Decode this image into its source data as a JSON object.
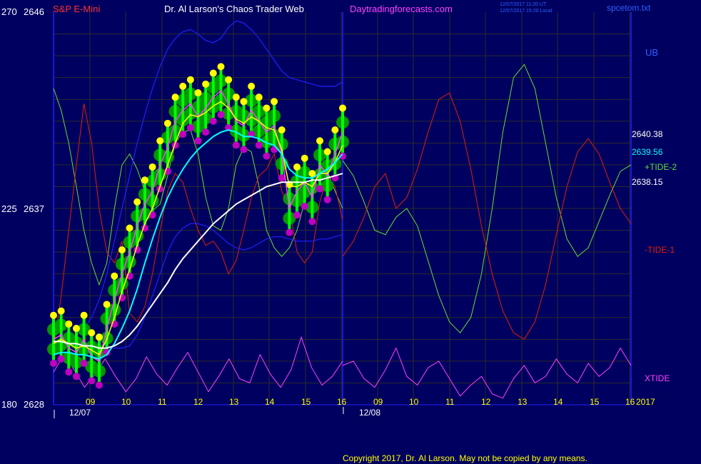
{
  "header": {
    "symbol": "S&P E-Mini",
    "title": "Dr. Al Larson's Chaos Trader Web",
    "site": "Daytradingforecasts.com",
    "timestamp_1": "12/07/2017 11:20 UT",
    "timestamp_2": "12/07/2017 15:20 Local",
    "file": "spcetom.txt"
  },
  "footer": {
    "copyright": "Copyright 2017, Dr. Al Larson. May not be copied by any means."
  },
  "colors": {
    "background": "#000060",
    "grid": "#2b2b2b",
    "cursor": "#2020ff",
    "band": "#2020ff",
    "price": "#00ff00",
    "price_halo": "#009900",
    "high_dot": "#ffff00",
    "low_dot": "#c000c0",
    "fast_avg": "#ffff00",
    "med_avg": "#ff40ff",
    "slow_avg": "#00ffff",
    "long_avg": "#ffffff",
    "tide_plus2": "#66dd33",
    "tide_minus1": "#e02000",
    "xtide": "#ff40ff",
    "text_white": "#ffffff",
    "text_yellow": "#ffff00",
    "text_red": "#ff3030",
    "text_magenta": "#ff40ff",
    "text_blue": "#3060ff"
  },
  "chart_data": {
    "type": "line",
    "title": "S&P E-Mini",
    "ylim": [
      2628,
      2646
    ],
    "left_axis": [
      {
        "left": "270",
        "right": "2646"
      },
      {
        "left": "225",
        "right": "2637"
      },
      {
        "left": "180",
        "right": "2628"
      }
    ],
    "x_hour_labels": [
      "09",
      "10",
      "11",
      "12",
      "13",
      "14",
      "15",
      "16",
      "09",
      "10",
      "11",
      "12",
      "13",
      "14",
      "15",
      "16"
    ],
    "date_labels": [
      "12/07",
      "12/08"
    ],
    "year_label": "2017",
    "right_labels": {
      "ub": "UB",
      "price_last": "2640.38",
      "slow_avg_last": "2639.56",
      "tide_plus2": "+TIDE-2",
      "long_avg_last": "2638.15",
      "tide_minus1": "-TIDE-1",
      "xtide": "XTIDE"
    },
    "price_close": [
      2631.0,
      2631.2,
      2630.6,
      2630.4,
      2631.0,
      2630.2,
      2630.0,
      2631.5,
      2632.8,
      2634.0,
      2635.0,
      2636.2,
      2637.2,
      2637.8,
      2639.0,
      2639.8,
      2641.0,
      2641.5,
      2641.8,
      2641.2,
      2641.6,
      2642.1,
      2642.4,
      2641.8,
      2641.0,
      2640.8,
      2641.5,
      2641.0,
      2640.5,
      2640.8,
      2639.5,
      2637.0,
      2637.8,
      2638.2,
      2637.5,
      2639.0,
      2638.5,
      2639.5,
      2640.5
    ],
    "avg_fast": [
      2630.8,
      2631.0,
      2630.8,
      2630.6,
      2630.7,
      2630.5,
      2630.3,
      2631.0,
      2632.0,
      2633.2,
      2634.2,
      2635.3,
      2636.3,
      2637.0,
      2638.0,
      2639.0,
      2640.0,
      2640.9,
      2641.3,
      2641.2,
      2641.4,
      2641.7,
      2641.9,
      2641.6,
      2641.1,
      2640.9,
      2641.2,
      2641.0,
      2640.7,
      2640.6,
      2639.7,
      2638.0,
      2638.0,
      2638.2,
      2638.0,
      2638.6,
      2638.6,
      2639.1,
      2639.9
    ],
    "avg_slow": [
      2630.3,
      2630.4,
      2630.4,
      2630.3,
      2630.3,
      2630.2,
      2630.1,
      2630.3,
      2630.8,
      2631.5,
      2632.3,
      2633.3,
      2634.5,
      2635.6,
      2636.6,
      2637.5,
      2638.2,
      2638.8,
      2639.3,
      2639.7,
      2640.0,
      2640.3,
      2640.5,
      2640.6,
      2640.5,
      2640.3,
      2640.3,
      2640.2,
      2640.0,
      2639.9,
      2639.5,
      2638.8,
      2638.5,
      2638.4,
      2638.4,
      2638.6,
      2638.8,
      2639.1,
      2639.5
    ],
    "avg_long": [
      2630.9,
      2630.9,
      2630.8,
      2630.8,
      2630.7,
      2630.7,
      2630.6,
      2630.6,
      2630.7,
      2630.9,
      2631.2,
      2631.6,
      2632.1,
      2632.6,
      2633.1,
      2633.6,
      2634.2,
      2634.7,
      2635.1,
      2635.5,
      2635.9,
      2636.3,
      2636.6,
      2636.9,
      2637.2,
      2637.4,
      2637.6,
      2637.8,
      2638.0,
      2638.1,
      2638.2,
      2638.2,
      2638.2,
      2638.2,
      2638.3,
      2638.3,
      2638.4,
      2638.5,
      2638.6
    ],
    "upper_band": [
      2630.5,
      2630.8,
      2631.0,
      2631.2,
      2631.5,
      2632.0,
      2632.8,
      2634.0,
      2635.5,
      2637.0,
      2638.5,
      2640.0,
      2641.3,
      2642.5,
      2643.5,
      2644.3,
      2644.8,
      2645.1,
      2645.2,
      2645.0,
      2644.7,
      2644.6,
      2644.8,
      2645.3,
      2645.6,
      2645.5,
      2645.2,
      2644.8,
      2644.3,
      2643.8,
      2643.3,
      2643.0,
      2642.9,
      2642.8,
      2642.7,
      2642.6,
      2642.6,
      2642.6,
      2642.8
    ],
    "lower_band": [
      2630.0,
      2630.1,
      2630.3,
      2630.4,
      2630.6,
      2630.7,
      2630.8,
      2630.7,
      2630.6,
      2630.6,
      2630.7,
      2631.2,
      2632.0,
      2633.0,
      2634.0,
      2635.0,
      2635.7,
      2636.1,
      2636.3,
      2636.3,
      2636.2,
      2636.0,
      2635.7,
      2635.4,
      2635.2,
      2635.1,
      2635.2,
      2635.4,
      2635.6,
      2635.7,
      2635.7,
      2635.6,
      2635.5,
      2635.5,
      2635.5,
      2635.6,
      2635.6,
      2635.7,
      2635.8
    ],
    "tide_plus2": [
      2642.5,
      2641.5,
      2640.0,
      2638.0,
      2636.0,
      2634.5,
      2633.5,
      2634.5,
      2637.0,
      2639.0,
      2639.5,
      2638.8,
      2637.8,
      2636.9,
      2637.2,
      2638.5,
      2640.0,
      2640.5,
      2640.6,
      2639.5,
      2637.5,
      2636.2,
      2636.0,
      2637.0,
      2639.0,
      2639.8,
      2639.6,
      2638.0,
      2636.0,
      2635.2,
      2634.8,
      2635.2,
      2636.0,
      2637.3,
      2638.5,
      2638.9,
      2638.7,
      2637.8,
      2637.0
    ],
    "tide_minus1": [
      2630.5,
      2633.0,
      2636.0,
      2639.0,
      2641.8,
      2640.0,
      2637.0,
      2635.0,
      2634.5,
      2635.5,
      2632.2,
      2631.8,
      2632.5,
      2634.0,
      2636.0,
      2637.8,
      2638.6,
      2638.2,
      2637.0,
      2636.0,
      2635.3,
      2635.5,
      2635.0,
      2634.0,
      2634.6,
      2636.0,
      2637.5,
      2638.5,
      2638.8,
      2639.5,
      2637.8,
      2637.0,
      2635.0,
      2634.5,
      2635.0,
      2637.3,
      2638.5,
      2638.0,
      2636.5
    ],
    "tide_future_plus2": [
      2639.2,
      2638.5,
      2637.3,
      2636.0,
      2635.8,
      2636.6,
      2637.0,
      2636.2,
      2634.6,
      2633.0,
      2631.8,
      2631.3,
      2632.0,
      2634.0,
      2637.0,
      2640.5,
      2643.0,
      2643.6,
      2642.5,
      2640.0,
      2637.5,
      2635.6,
      2634.8,
      2635.2,
      2636.4,
      2637.6,
      2638.7,
      2639.0
    ],
    "tide_future_minus1": [
      2634.8,
      2635.5,
      2636.6,
      2638.0,
      2638.6,
      2637.0,
      2637.5,
      2638.8,
      2640.5,
      2642.0,
      2642.3,
      2641.0,
      2638.8,
      2636.2,
      2634.0,
      2632.3,
      2631.3,
      2631.0,
      2631.8,
      2633.5,
      2635.8,
      2638.0,
      2639.6,
      2640.2,
      2639.5,
      2638.2,
      2637.0,
      2636.3
    ],
    "xtide": [
      2629.5,
      2630.3,
      2629.6,
      2628.8,
      2629.4,
      2630.1,
      2629.3,
      2628.6,
      2629.2,
      2630.2,
      2629.4,
      2628.9,
      2629.7,
      2630.4,
      2629.5,
      2628.6,
      2629.3,
      2630.1,
      2629.2,
      2629.0,
      2630.3,
      2629.4,
      2628.8,
      2629.6,
      2631.1,
      2629.7,
      2628.9,
      2629.3,
      2630.0
    ],
    "xtide_future": [
      2629.8,
      2630.0,
      2629.2,
      2628.8,
      2629.6,
      2630.6,
      2629.3,
      2628.9,
      2629.7,
      2630.0,
      2629.2,
      2628.4,
      2628.9,
      2629.3,
      2628.5,
      2628.3,
      2629.2,
      2629.8,
      2629.0,
      2629.3,
      2630.1,
      2629.4,
      2629.0,
      2629.9,
      2629.3,
      2629.7,
      2630.6,
      2629.8
    ]
  }
}
